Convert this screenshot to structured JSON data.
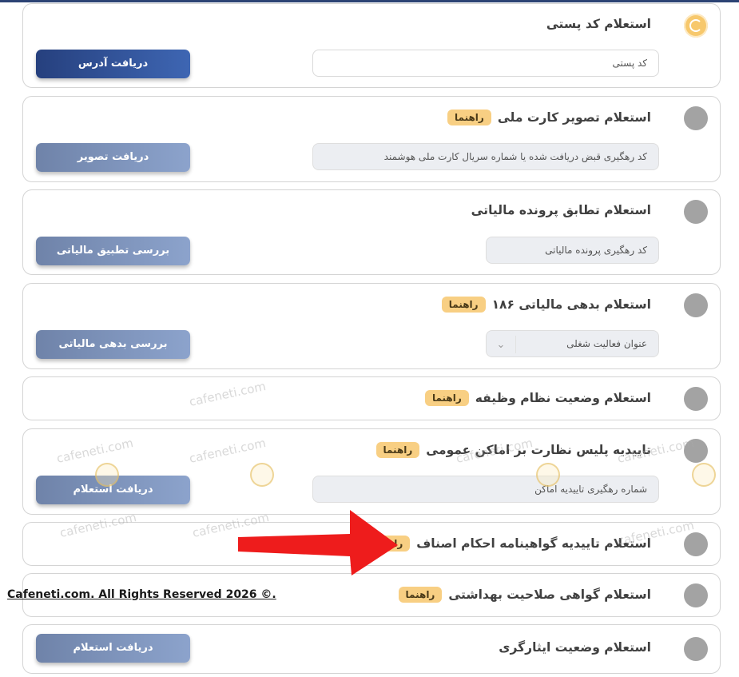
{
  "cards": [
    {
      "title": "استعلام کد پستی",
      "field_placeholder": "کد پستی",
      "button": "دریافت آدرس"
    },
    {
      "title": "استعلام تصویر کارت ملی",
      "badge": "راهنما",
      "field_placeholder": "کد رهگیری قبض دریافت شده یا شماره سریال کارت  ملی هوشمند",
      "button": "دریافت تصویر"
    },
    {
      "title": "استعلام تطابق پرونده مالیاتی",
      "field_placeholder": "کد رهگیری پرونده مالیاتی",
      "button": "بررسی تطبیق مالیاتی"
    },
    {
      "title": "استعلام بدهی مالیاتی ۱۸۶",
      "badge": "راهنما",
      "select_value": "عنوان فعالیت شغلی",
      "button": "بررسی بدهی مالیاتی"
    },
    {
      "title": "استعلام وضعیت نظام وظیفه",
      "badge": "راهنما"
    },
    {
      "title": "تاییدیه پلیس نظارت بر اماکن عمومی",
      "badge": "راهنما",
      "field_placeholder": "شماره رهگیری تاییدیه اماکن",
      "button": "دریافت استعلام"
    },
    {
      "title": "استعلام تاییدیه گواهینامه احکام اصناف",
      "badge": "راهنما"
    },
    {
      "title": "استعلام گواهی صلاحیت بهداشتی",
      "badge": "راهنما"
    },
    {
      "title": "استعلام وضعیت ایثارگری",
      "button": "دریافت استعلام"
    }
  ],
  "watermark_text": "cafeneti.com",
  "copyright": "Cafeneti.com. All Rights Reserved 2026 ©.",
  "icons": {
    "select_chevron": "⌄"
  },
  "colors": {
    "accent": "#f7c86c",
    "primary_button": "#2c4a92",
    "muted_button": "#7d92bb",
    "badge": "#f8cf83",
    "arrow": "#ee1c1c"
  }
}
